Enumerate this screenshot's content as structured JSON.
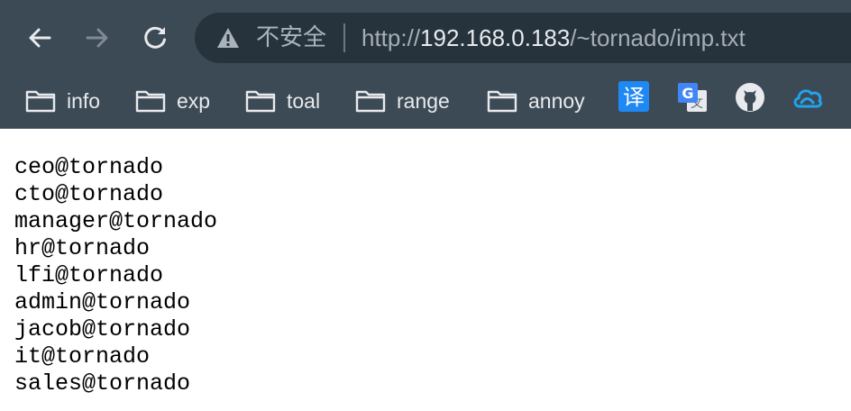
{
  "browser": {
    "address_bar": {
      "security_label": "不安全",
      "url_prefix": "http://",
      "url_host": "192.168.0.183",
      "url_path": "/~tornado/imp.txt"
    },
    "bookmarks": [
      {
        "label": "info",
        "icon": "folder-icon"
      },
      {
        "label": "exp",
        "icon": "folder-icon"
      },
      {
        "label": "toal",
        "icon": "folder-icon"
      },
      {
        "label": "range",
        "icon": "folder-icon"
      },
      {
        "label": "annoy",
        "icon": "folder-icon"
      }
    ],
    "extensions": [
      {
        "icon": "translate-icon",
        "glyph": "译"
      },
      {
        "icon": "google-translate-icon",
        "glyph": "G"
      },
      {
        "icon": "github-icon"
      },
      {
        "icon": "cloud-icon"
      }
    ]
  },
  "document": {
    "lines": [
      "ceo@tornado",
      "cto@tornado",
      "manager@tornado",
      "hr@tornado",
      "lfi@tornado",
      "admin@tornado",
      "jacob@tornado",
      "it@tornado",
      "sales@tornado"
    ]
  },
  "colors": {
    "chrome_bg": "#3c4a55",
    "omnibox_bg": "#26333d",
    "translate_blue": "#1e88f5"
  }
}
